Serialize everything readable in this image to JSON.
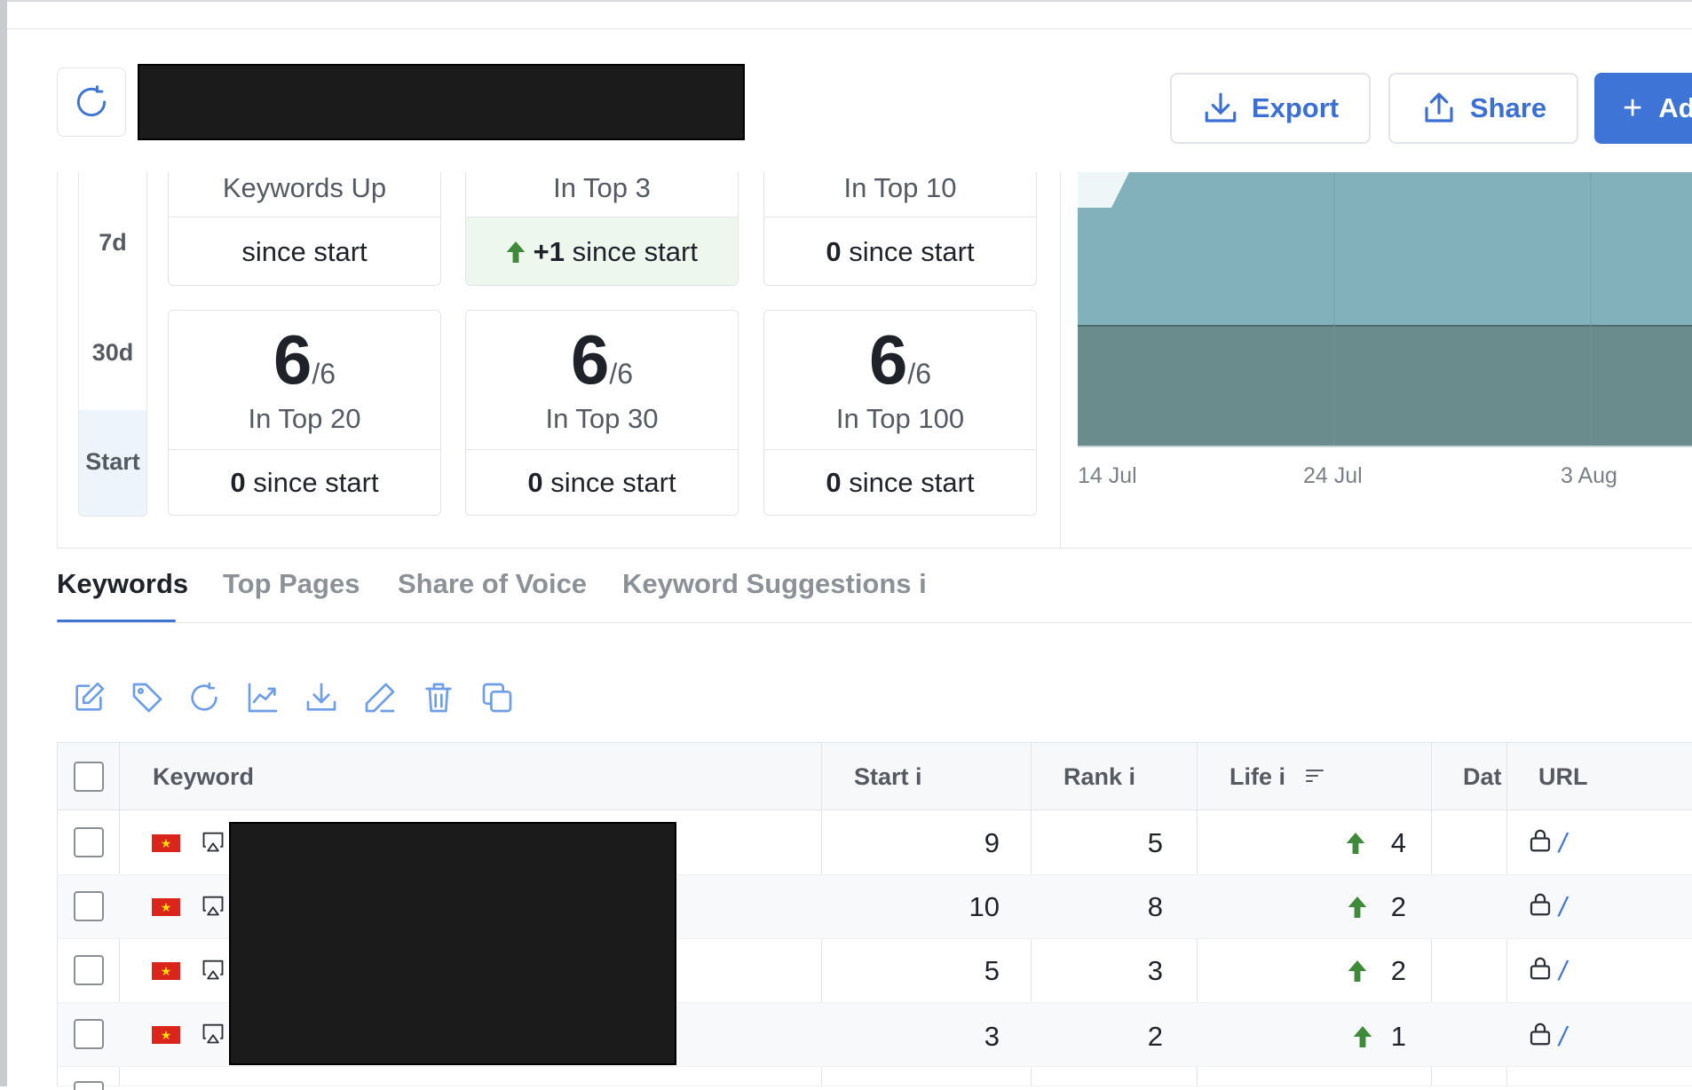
{
  "header": {
    "export_label": "Export",
    "share_label": "Share",
    "add_label": "Ad"
  },
  "periods": [
    "7d",
    "30d",
    "Start"
  ],
  "summary_cards": [
    {
      "label": "Keywords Up",
      "delta": "",
      "foot_text": "since start"
    },
    {
      "label": "In Top 3",
      "delta": "+1",
      "foot_text": "since start",
      "trend": "up"
    },
    {
      "label": "In Top 10",
      "delta": "0",
      "foot_text": "since start"
    },
    {
      "label": "In Top 20",
      "value": "6",
      "total": "/6",
      "delta": "0",
      "foot_text": "since start"
    },
    {
      "label": "In Top 30",
      "value": "6",
      "total": "/6",
      "delta": "0",
      "foot_text": "since start"
    },
    {
      "label": "In Top 100",
      "value": "6",
      "total": "/6",
      "delta": "0",
      "foot_text": "since start"
    }
  ],
  "chart_data": {
    "type": "area",
    "x": [
      "14 Jul",
      "24 Jul",
      "3 Aug"
    ],
    "colors": [
      "#82b0bb",
      "#6a8c8d"
    ],
    "grid": true
  },
  "tabs": [
    "Keywords",
    "Top Pages",
    "Share of Voice",
    "Keyword Suggestions i"
  ],
  "toolbar_icons": [
    "edit-icon",
    "tag-icon",
    "refresh-icon",
    "chart-icon",
    "download-icon",
    "pencil-icon",
    "trash-icon",
    "copy-icon"
  ],
  "table": {
    "columns": {
      "keyword": "Keyword",
      "start": "Start i",
      "rank": "Rank i",
      "life": "Life i",
      "date": "Dat",
      "url": "URL"
    },
    "rows": [
      {
        "start": "9",
        "rank": "5",
        "life": "4",
        "url": "/"
      },
      {
        "start": "10",
        "rank": "8",
        "life": "2",
        "url": "/"
      },
      {
        "start": "5",
        "rank": "3",
        "life": "2",
        "url": "/"
      },
      {
        "start": "3",
        "rank": "2",
        "life": "1",
        "url": "/"
      }
    ]
  },
  "colors": {
    "accent": "#3e74d6",
    "up_green": "#3f8a3a"
  }
}
